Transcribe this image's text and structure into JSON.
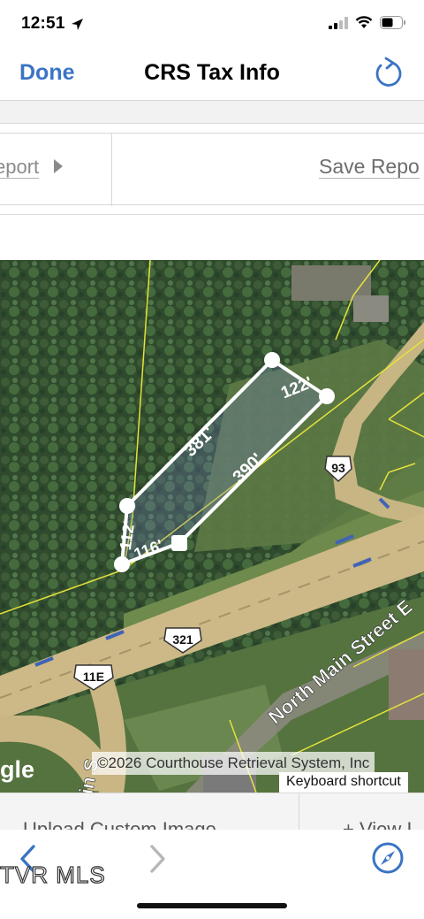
{
  "status_bar": {
    "time": "12:51",
    "icons": [
      "location-arrow-icon",
      "signal-icon",
      "wifi-icon",
      "battery-icon"
    ]
  },
  "nav": {
    "done_label": "Done",
    "title": "CRS Tax Info",
    "refresh_icon": "refresh-icon",
    "accent_color": "#3a74c4"
  },
  "toolbar": {
    "report_label": "eport",
    "save_report_label": "Save Repo"
  },
  "map": {
    "parcel_dimensions": [
      "122'",
      "381'",
      "390'",
      "112'",
      "116'"
    ],
    "road_shields": [
      "93",
      "321",
      "11E"
    ],
    "street_labels": [
      "North Main Street E",
      "in S"
    ],
    "copyright": "©2026 Courthouse Retrieval System, Inc",
    "keyboard_shortcuts": "Keyboard shortcut",
    "provider_logo": "gle"
  },
  "bottom": {
    "upload_label": "Upload Custom Image",
    "view_label": "+ View I"
  },
  "browser": {
    "back_icon": "chevron-left-icon",
    "forward_icon": "chevron-right-icon",
    "compass_icon": "compass-icon"
  },
  "watermark": "TVR MLS"
}
